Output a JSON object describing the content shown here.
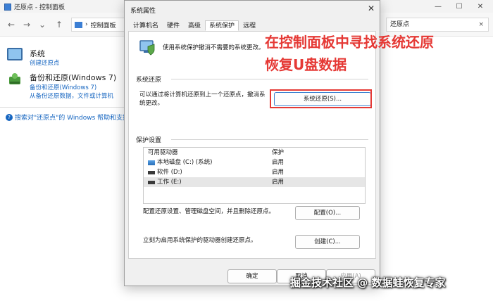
{
  "background_window": {
    "title": "还原点 - 控制面板",
    "breadcrumb": "控制面板",
    "search_value": "还原点",
    "search_clear": "×",
    "items": [
      {
        "title": "系统",
        "links": [
          "创建还原点"
        ]
      },
      {
        "title": "备份和还原(Windows 7)",
        "links": [
          "备份和还原(Windows 7)",
          "从备份还原数据，文件或计算机"
        ]
      }
    ],
    "help_text": "搜索对\"还原点\"的 Windows 帮助和支持",
    "help_glyph": "?",
    "nav": {
      "back": "←",
      "forward": "→",
      "up": "↑",
      "refresh": "↻",
      "chevron": "›",
      "dropdown": "⌄"
    },
    "controls": {
      "minimize": "—",
      "maximize": "☐",
      "close": "✕"
    }
  },
  "dialog": {
    "title": "系统属性",
    "close": "✕",
    "tabs": [
      "计算机名",
      "硬件",
      "高级",
      "系统保护",
      "远程"
    ],
    "active_tab": 3,
    "intro": "使用系统保护撤消不需要的系统更改。",
    "restore_section": {
      "label": "系统还原",
      "text_line1": "可以通过将计算机还原到上一个还原点，撤消系",
      "text_line2": "统更改。",
      "button": "系统还原(S)..."
    },
    "protection_section": {
      "label": "保护设置",
      "columns": [
        "可用驱动器",
        "保护"
      ],
      "drives": [
        {
          "name": "本地磁盘 (C:) (系统)",
          "protection": "启用"
        },
        {
          "name": "软件 (D:)",
          "protection": "启用"
        },
        {
          "name": "工作 (E:)",
          "protection": "启用"
        }
      ],
      "configure_text": "配置还原设置、管理磁盘空间，并且删除还原点。",
      "configure_button": "配置(O)...",
      "create_text": "立刻为启用系统保护的驱动器创建还原点。",
      "create_button": "创建(C)..."
    },
    "footer": {
      "ok": "确定",
      "cancel": "取消",
      "apply": "应用(A)"
    }
  },
  "overlay": {
    "lines": [
      "在控制面板中寻找系统还原",
      "恢复U盘数据"
    ],
    "color": "#e53935"
  },
  "watermark": "掘金技术社区 @ 数据蛙恢复专家"
}
